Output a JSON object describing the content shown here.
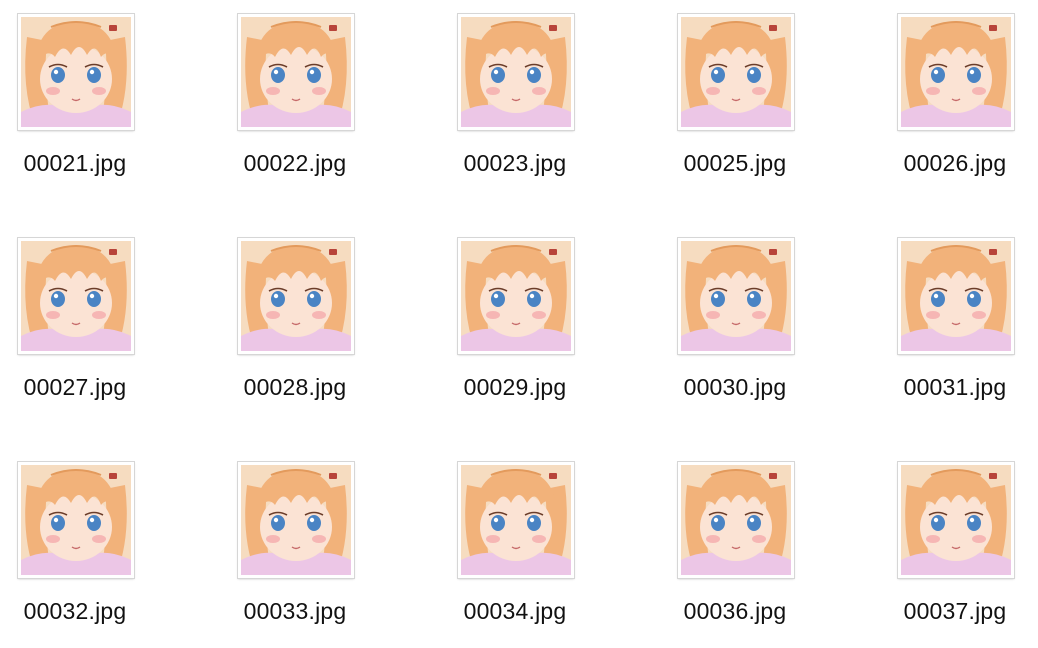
{
  "files": [
    {
      "name": "00021.jpg",
      "icon": "image-thumbnail-icon"
    },
    {
      "name": "00022.jpg",
      "icon": "image-thumbnail-icon"
    },
    {
      "name": "00023.jpg",
      "icon": "image-thumbnail-icon"
    },
    {
      "name": "00025.jpg",
      "icon": "image-thumbnail-icon"
    },
    {
      "name": "00026.jpg",
      "icon": "image-thumbnail-icon"
    },
    {
      "name": "00027.jpg",
      "icon": "image-thumbnail-icon"
    },
    {
      "name": "00028.jpg",
      "icon": "image-thumbnail-icon"
    },
    {
      "name": "00029.jpg",
      "icon": "image-thumbnail-icon"
    },
    {
      "name": "00030.jpg",
      "icon": "image-thumbnail-icon"
    },
    {
      "name": "00031.jpg",
      "icon": "image-thumbnail-icon"
    },
    {
      "name": "00032.jpg",
      "icon": "image-thumbnail-icon"
    },
    {
      "name": "00033.jpg",
      "icon": "image-thumbnail-icon"
    },
    {
      "name": "00034.jpg",
      "icon": "image-thumbnail-icon"
    },
    {
      "name": "00036.jpg",
      "icon": "image-thumbnail-icon"
    },
    {
      "name": "00037.jpg",
      "icon": "image-thumbnail-icon"
    }
  ],
  "colors": {
    "hair": "#f2b27a",
    "hair_dark": "#e39a5c",
    "skin": "#fbe3d4",
    "blush": "#f4a3a6",
    "eye": "#4a84c4",
    "dress": "#ecc6e6",
    "bg_warm": "#f6dcc0",
    "bow": "#b8443a"
  }
}
